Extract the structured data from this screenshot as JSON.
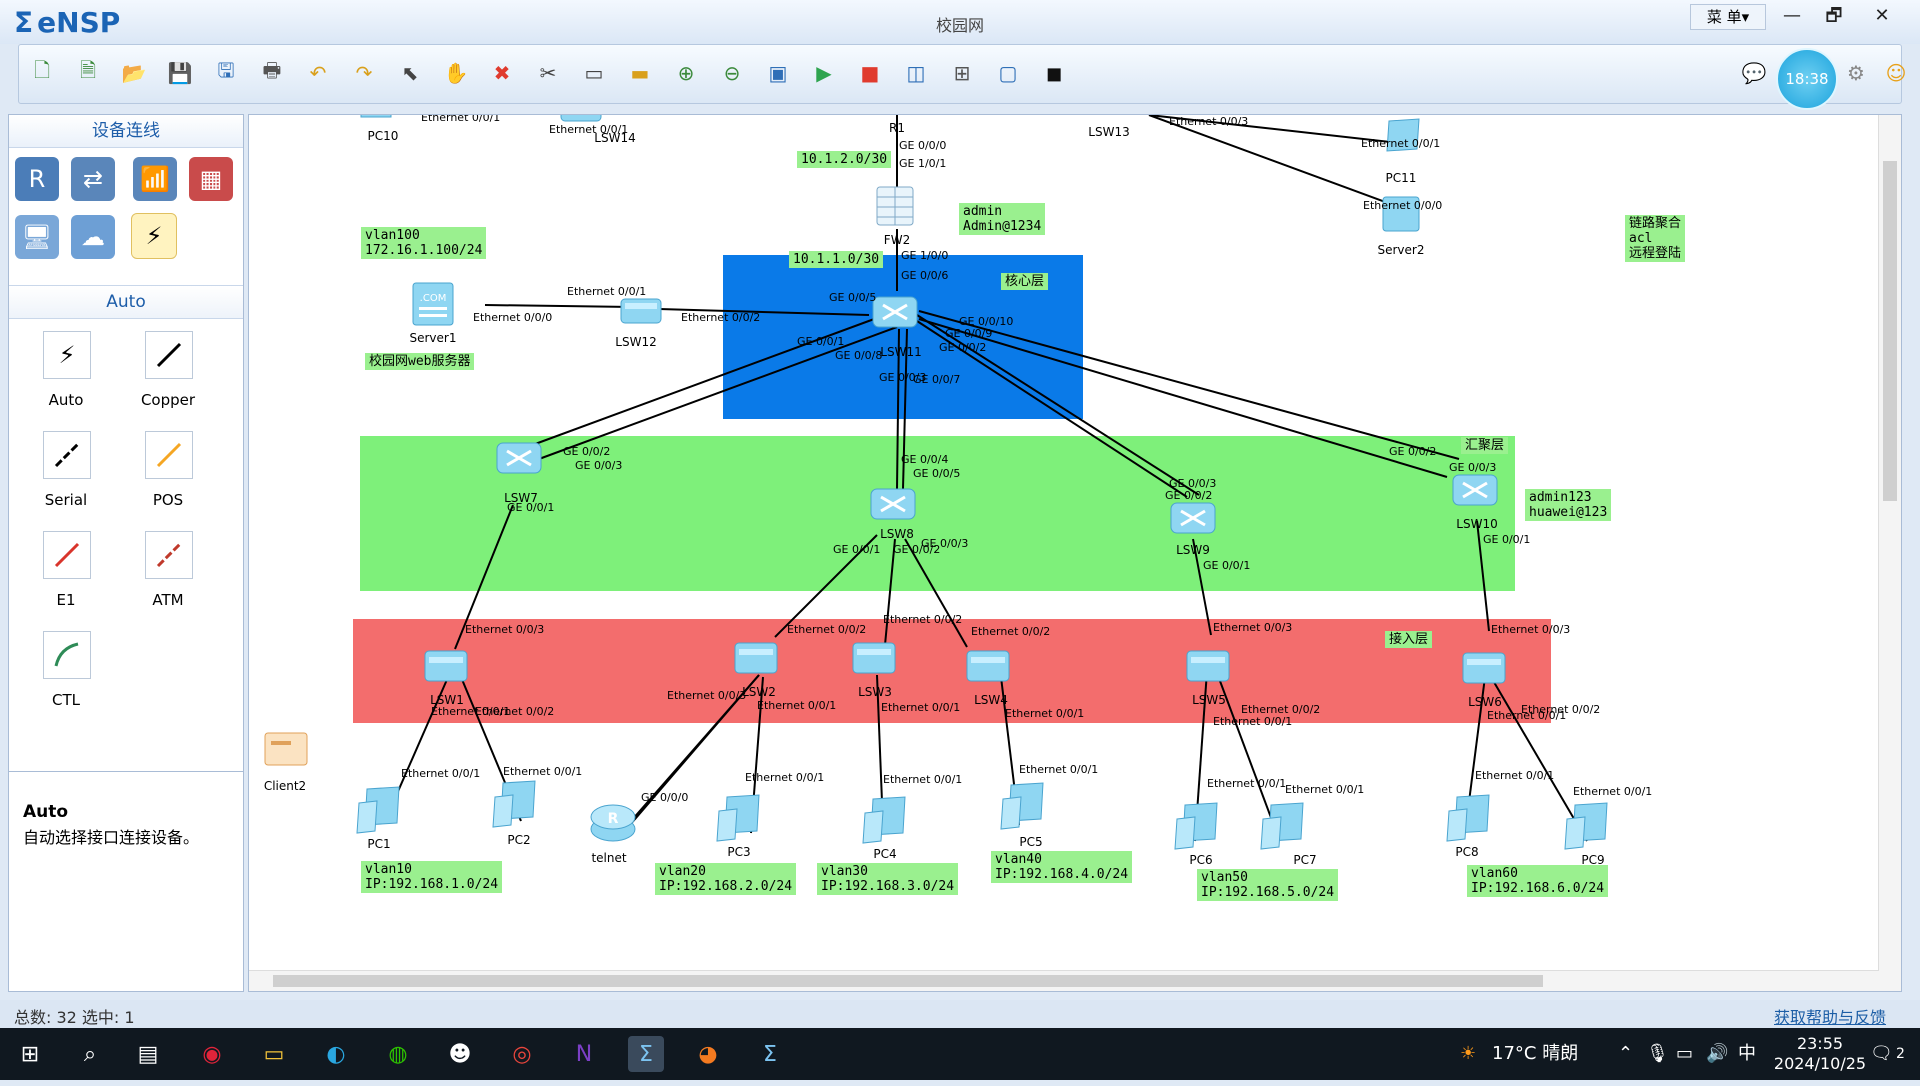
{
  "app": {
    "title": "eNSP",
    "window_title": "校园网",
    "menu_label": "菜 单▾"
  },
  "window_controls": {
    "minimize": "—",
    "restore": "🗗",
    "close": "✕"
  },
  "toolbar": {
    "clock": "18:38"
  },
  "left_panel": {
    "device_header": "设备连线",
    "auto_header": "Auto",
    "cables": [
      "Auto",
      "Copper",
      "Serial",
      "POS",
      "E1",
      "ATM",
      "CTL"
    ],
    "desc_title": "Auto",
    "desc_body": "自动选择接口连接设备。"
  },
  "zones": {
    "core": "核心层",
    "aggregation": "汇聚层",
    "access": "接入层"
  },
  "notes": {
    "vlan100": "vlan100\n172.16.1.100/24",
    "web_server": "校园网web服务器",
    "net_r1_fw": "10.1.2.0/30",
    "net_fw_core": "10.1.1.0/30",
    "fw_cred": "admin\nAdmin@1234",
    "features": "链路聚合\nacl\n远程登陆",
    "agg_cred": "admin123\nhuawei@123",
    "vlan10": "vlan10\nIP:192.168.1.0/24",
    "vlan20": "vlan20\nIP:192.168.2.0/24",
    "vlan30": "vlan30\nIP:192.168.3.0/24",
    "vlan40": "vlan40\nIP:192.168.4.0/24",
    "vlan50": "vlan50\nIP:192.168.5.0/24",
    "vlan60": "vlan60\nIP:192.168.6.0/24"
  },
  "devices": {
    "pc10": "PC10",
    "lsw14": "LSW14",
    "r1": "R1",
    "lsw13": "LSW13",
    "pc11": "PC11",
    "server2": "Server2",
    "fw2": "FW2",
    "server1": "Server1",
    "lsw12": "LSW12",
    "lsw11": "LSW11",
    "lsw7": "LSW7",
    "lsw8": "LSW8",
    "lsw9": "LSW9",
    "lsw10": "LSW10",
    "lsw1": "LSW1",
    "lsw2": "LSW2",
    "lsw3": "LSW3",
    "lsw4": "LSW4",
    "lsw5": "LSW5",
    "lsw6": "LSW6",
    "client2": "Client2",
    "pc1": "PC1",
    "pc2": "PC2",
    "telnet": "telnet",
    "pc3": "PC3",
    "pc4": "PC4",
    "pc5": "PC5",
    "pc6": "PC6",
    "pc7": "PC7",
    "pc8": "PC8",
    "pc9": "PC9"
  },
  "ports": {
    "eth001": "Ethernet 0/0/1",
    "eth000": "Ethernet 0/0/0",
    "eth002": "Ethernet 0/0/2",
    "eth003": "Ethernet 0/0/3",
    "ge000": "GE 0/0/0",
    "ge001": "GE 0/0/1",
    "ge002": "GE 0/0/2",
    "ge003": "GE 0/0/3",
    "ge004": "GE 0/0/4",
    "ge005": "GE 0/0/5",
    "ge006": "GE 0/0/6",
    "ge007": "GE 0/0/7",
    "ge008": "GE 0/0/8",
    "ge009": "GE 0/0/9",
    "ge0010": "GE 0/0/10",
    "ge100": "GE 1/0/0",
    "ge101": "GE 1/0/1"
  },
  "status": {
    "total": "总数: 32 选中: 1",
    "help": "获取帮助与反馈"
  },
  "taskbar": {
    "weather": "17°C 晴朗",
    "ime": "中",
    "time": "23:55",
    "date": "2024/10/25",
    "notif": "2"
  }
}
